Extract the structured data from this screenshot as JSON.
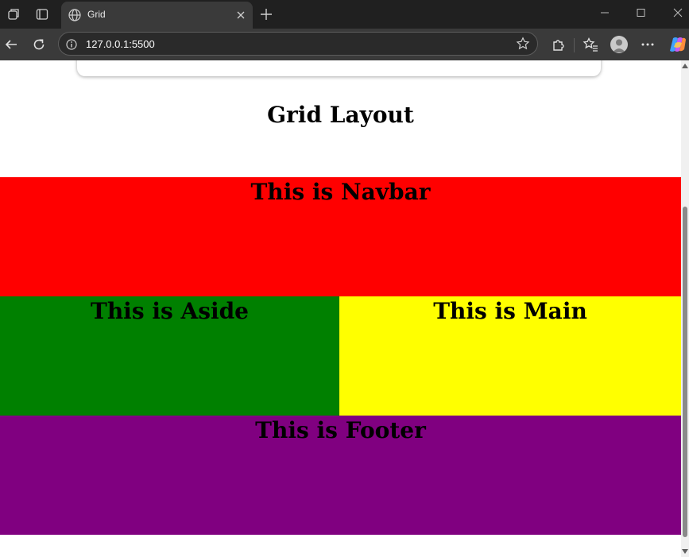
{
  "browser": {
    "tab_title": "Grid",
    "url": "127.0.0.1:5500",
    "icons": [
      "workspaces-icon",
      "tab-actions-icon",
      "globe-icon",
      "close-icon",
      "new-tab-icon",
      "minimize-icon",
      "maximize-icon",
      "window-close-icon",
      "back-icon",
      "refresh-icon",
      "site-info-icon",
      "favorite-star-icon",
      "extensions-icon",
      "favorites-icon",
      "profile-avatar",
      "more-icon",
      "copilot-icon"
    ]
  },
  "page": {
    "heading": "Grid Layout",
    "grid": {
      "navbar": "This is Navbar",
      "aside": "This is Aside",
      "main": "This is Main",
      "footer": "This is Footer"
    },
    "colors": {
      "navbar": "#ff0000",
      "aside": "#008000",
      "main": "#ffff00",
      "footer": "#800080"
    }
  }
}
